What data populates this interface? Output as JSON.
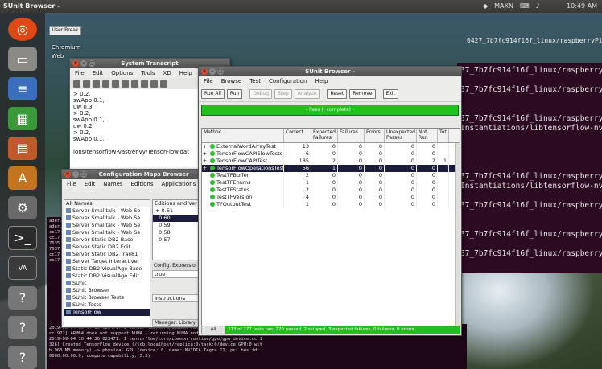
{
  "topbar": {
    "title": "SUnit Browser -",
    "tray_text": "10:49 AM",
    "network": "MAXN"
  },
  "launcher": {
    "icons": [
      "ubuntu-icon",
      "files-icon",
      "document-icon",
      "spreadsheet-icon",
      "presentation-icon",
      "software-icon",
      "settings-icon",
      "terminal-icon",
      "vast-icon",
      "question-icon",
      "question-icon-2",
      "question-icon-3"
    ]
  },
  "desktop": {
    "labels": [
      "Chromium",
      "Web"
    ],
    "user_break": "User Break"
  },
  "terminal": {
    "top_line": "0427_7b7fc914f16f_linux/raspberryPi",
    "lines": [
      "37_7b7fc914f16f_linux/raspberry",
      "",
      "37_7b7fc914f16f_linux/raspberry",
      "",
      "",
      "37_7b7fc914f16f_linux/raspberry",
      "Instantiations/libtensorflow-nv",
      "",
      "",
      "",
      "",
      "37_7b7fc914f16f_linux/raspberry",
      "Instantiations/libtensorflow-nv",
      "",
      "37_7b7fc914f16f_linux/raspberry",
      "",
      "",
      "37_7b7fc914f16f_linux/raspberry",
      "",
      "37_7b7fc914f16f_linux/raspberry"
    ]
  },
  "bottom_terminal": {
    "left_lines": [
      "ader.",
      "ader.",
      "cc17",
      "cc17",
      "7635",
      "7637",
      "cc17",
      "cc17"
    ],
    "wide_lines": [
      "2019-09 04 10:44:30.023471: I tensorflow/core/common_runtime/gpu/gpu_device.cc:1",
      "cc:972] ARM64 does not support NUMA - returning NUMA node zero",
      "2019-09-04 10:44:30.023471: I tensorflow/core/common_runtime/gpu/gpu_device.cc:1",
      "326] Created TensorFlow device (/job:localhost/replica:0/task:0/device:GPU:0 wit",
      "h 963 MB memory) -> physical GPU (device: 0, name: NVIDIA Tegra X1, pci bus id:",
      "0000:00:00.0, compute capability: 5.3)"
    ]
  },
  "transcript": {
    "title": "System Transcript",
    "menu": [
      "File",
      "Edit",
      "Options",
      "Tools",
      "XD",
      "Help"
    ],
    "lines": [
      "> 0.2,",
      "swApp 0.1,",
      "uw 0.3,",
      "> 0.2,",
      "swApp 0.1,",
      "uw 0.2,",
      "> 0.2,",
      "swApp 0.1,",
      "",
      "ions/tensorflow-vast/envy/TensorFlow.dat"
    ]
  },
  "cmb": {
    "title": "Configuration Maps Browser",
    "menu": [
      "File",
      "Edit",
      "Names",
      "Editions",
      "Applications"
    ],
    "list_header": "All Names",
    "items": [
      "Server Smalltalk - Web Se",
      "Server Smalltalk - Web Se",
      "Server Smalltalk - Web Se",
      "Server Smalltalk - Web Se",
      "Server Static DB2 Base",
      "Server Static DB2 Edit",
      "Server Static DB2 Trail81",
      "Server Target Interactive",
      "Static DB2 VisualAge Base",
      "Static DB2 VisualAge Edit",
      "SUnit",
      "SUnit Browser",
      "SUnit Browser Tests",
      "SUnit Tests",
      "TensorFlow"
    ],
    "editions_header": "Editions and Ver",
    "editions": [
      "0.61",
      "0.60",
      "0.59",
      "0.58",
      "0.57"
    ],
    "tab_label": "Config. Expressio",
    "expression": "true",
    "instructions": "Instructions",
    "footer": "Manager: Library"
  },
  "sunit": {
    "title": "SUnit Browser -",
    "menu": [
      "File",
      "Browse",
      "Test",
      "Configuration",
      "Help"
    ],
    "buttons": [
      "Run All",
      "Run",
      "Debug",
      "Step",
      "Analyze",
      "Reset",
      "Remove",
      "Exit"
    ],
    "status": "- Pass (- complete) -",
    "columns": [
      "Method",
      "Correct",
      "Expected Failures",
      "Failures",
      "Errors",
      "Unexpected Passes",
      "Not Run",
      "Tot"
    ],
    "rows": [
      {
        "expand": "+",
        "name": "ExternalWordArrayTest",
        "correct": "13",
        "expf": "0",
        "fail": "0",
        "err": "0",
        "unexp": "0",
        "nrun": "0",
        "tot": ""
      },
      {
        "expand": "+",
        "name": "TensorFlowCAPISlowTests",
        "correct": "6",
        "expf": "0",
        "fail": "0",
        "err": "0",
        "unexp": "0",
        "nrun": "0",
        "tot": ""
      },
      {
        "expand": "+",
        "name": "TensorFlowCAPITest",
        "correct": "185",
        "expf": "2",
        "fail": "0",
        "err": "0",
        "unexp": "0",
        "nrun": "2",
        "tot": "1"
      },
      {
        "expand": "+",
        "name": "TensorFlowOperationsTest",
        "correct": "56",
        "expf": "1",
        "fail": "0",
        "err": "0",
        "unexp": "0",
        "nrun": "0",
        "tot": ""
      },
      {
        "expand": "",
        "name": "TestTFBuffer",
        "correct": "2",
        "expf": "0",
        "fail": "0",
        "err": "0",
        "unexp": "0",
        "nrun": "0",
        "tot": ""
      },
      {
        "expand": "",
        "name": "TestTFEnums",
        "correct": "1",
        "expf": "0",
        "fail": "0",
        "err": "0",
        "unexp": "0",
        "nrun": "0",
        "tot": ""
      },
      {
        "expand": "",
        "name": "TestTFStatus",
        "correct": "2",
        "expf": "0",
        "fail": "0",
        "err": "0",
        "unexp": "0",
        "nrun": "0",
        "tot": ""
      },
      {
        "expand": "",
        "name": "TestTFVersion",
        "correct": "4",
        "expf": "0",
        "fail": "0",
        "err": "0",
        "unexp": "0",
        "nrun": "0",
        "tot": ""
      },
      {
        "expand": "",
        "name": "TFOutputTest",
        "correct": "1",
        "expf": "0",
        "fail": "0",
        "err": "0",
        "unexp": "0",
        "nrun": "0",
        "tot": ""
      }
    ],
    "selected_row": 3,
    "footer_tab": "All",
    "footer_status": "273 of 277 tests ran: 270 passed, 2 skipped, 3 expected failures, 0 failures, 0 errors"
  }
}
